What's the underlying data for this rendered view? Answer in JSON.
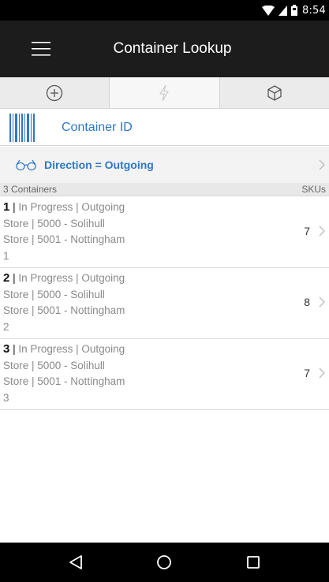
{
  "status_bar": {
    "time": "8:54",
    "icons": [
      "wifi-icon",
      "signal-icon",
      "battery-icon"
    ]
  },
  "app_bar": {
    "title": "Container Lookup",
    "menu_icon": "hamburger-menu-icon"
  },
  "tabs": [
    {
      "icon": "add-circle-icon",
      "active": false
    },
    {
      "icon": "lightning-icon",
      "active": true
    },
    {
      "icon": "package-box-icon",
      "active": false
    }
  ],
  "search": {
    "icon": "barcode-icon",
    "label": "Container ID"
  },
  "filter": {
    "icon": "glasses-icon",
    "label": "Direction = Outgoing"
  },
  "list_header": {
    "count_label": "3 Containers",
    "skus_label": "SKUs"
  },
  "containers": [
    {
      "number": "1",
      "separator": " |",
      "status": " In Progress | Outgoing",
      "from": "Store | 5000 - Solihull",
      "to": "Store | 5001 - Nottingham",
      "id": "1",
      "skus": "7"
    },
    {
      "number": "2",
      "separator": " |",
      "status": " In Progress | Outgoing",
      "from": "Store | 5000 - Solihull",
      "to": "Store | 5001 - Nottingham",
      "id": "2",
      "skus": "8"
    },
    {
      "number": "3",
      "separator": " |",
      "status": " In Progress | Outgoing",
      "from": "Store | 5000 - Solihull",
      "to": "Store | 5001 - Nottingham",
      "id": "3",
      "skus": "7"
    }
  ],
  "nav_bar": {
    "back_icon": "back-triangle-icon",
    "home_icon": "home-circle-icon",
    "recents_icon": "recents-square-icon"
  },
  "colors": {
    "accent": "#2e78c7",
    "app_bar": "#1c1c1c",
    "status_bar": "#000000"
  }
}
